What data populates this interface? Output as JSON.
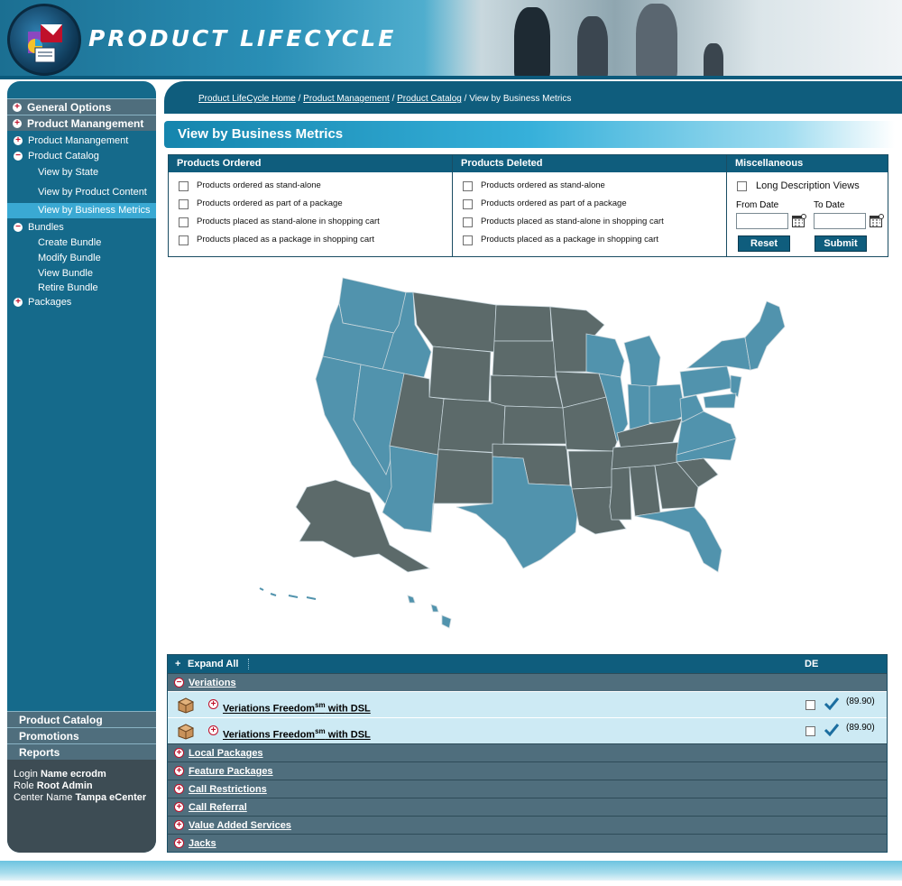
{
  "app": {
    "title": "PRODUCT LIFECYCLE"
  },
  "sidebar": {
    "sections": [
      {
        "label": "General Options"
      },
      {
        "label": "Product Manangement"
      }
    ],
    "items": [
      {
        "label": "Product Manangement"
      },
      {
        "label": "Product Catalog"
      },
      {
        "label": "View by State"
      },
      {
        "label": "View by Product Content"
      },
      {
        "label": "View by Business Metrics"
      },
      {
        "label": "Bundles"
      },
      {
        "label": "Create Bundle"
      },
      {
        "label": "Modify Bundle"
      },
      {
        "label": "View Bundle"
      },
      {
        "label": "Retire Bundle"
      },
      {
        "label": "Packages"
      }
    ],
    "bottom": [
      {
        "label": "Product Catalog"
      },
      {
        "label": "Promotions"
      },
      {
        "label": "Reports"
      }
    ],
    "login": {
      "login_label": "Login",
      "login_value": "Name ecrodm",
      "role_label": "Role",
      "role_value": "Root Admin",
      "center_label": "Center Name",
      "center_value": "Tampa eCenter"
    }
  },
  "breadcrumb": {
    "items": [
      "Product LifeCycle Home",
      "Product Management",
      "Product Catalog"
    ],
    "current": "View by Business Metrics",
    "separator": " / "
  },
  "page_title": "View by Business Metrics",
  "filters": {
    "ordered": {
      "header": "Products Ordered",
      "options": [
        "Products ordered as stand-alone",
        "Products ordered as part of a package",
        "Products placed as stand-alone in shopping cart",
        "Products placed as a package in shopping cart"
      ]
    },
    "deleted": {
      "header": "Products Deleted",
      "options": [
        "Products ordered as stand-alone",
        "Products ordered as part of a package",
        "Products placed as stand-alone in shopping cart",
        "Products placed as a package in shopping cart"
      ]
    },
    "misc": {
      "header": "Miscellaneous",
      "long_desc": "Long Description Views",
      "from_date": "From Date",
      "to_date": "To Date",
      "reset": "Reset",
      "submit": "Submit"
    }
  },
  "packages": {
    "expand_all": "Expand All",
    "column_de": "DE",
    "categories": [
      {
        "label": "Veriations",
        "expanded": true,
        "items": [
          {
            "name": "Veriations Freedom",
            "sup": "sm",
            "suffix": " with DSL",
            "price": "(89.90)"
          },
          {
            "name": "Veriations Freedom",
            "sup": "sm",
            "suffix": " with DSL",
            "price": "(89.90)"
          }
        ]
      },
      {
        "label": "Local Packages"
      },
      {
        "label": "Feature Packages"
      },
      {
        "label": "Call Restrictions"
      },
      {
        "label": "Call Referral"
      },
      {
        "label": "Value Added Services"
      },
      {
        "label": "Jacks"
      }
    ]
  },
  "colors": {
    "primary": "#0f5d7d",
    "sidebar": "#156a8b",
    "highlight": "#3aa9d3",
    "state_highlight": "#5193ad",
    "state_dark": "#5c6a6a"
  }
}
